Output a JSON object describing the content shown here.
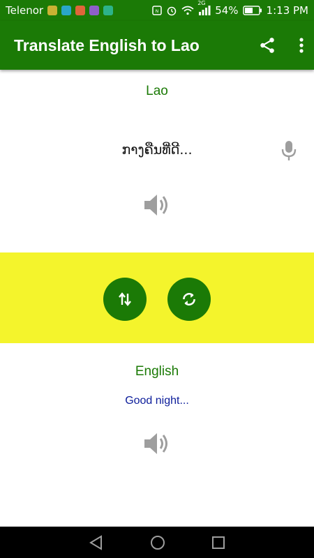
{
  "status_bar": {
    "carrier": "Telenor",
    "network": "2G",
    "battery": "54%",
    "time": "1:13 PM"
  },
  "app_bar": {
    "title": "Translate English to Lao",
    "icons": [
      "share-icon",
      "more-vert-icon"
    ]
  },
  "source": {
    "language": "Lao",
    "text": "ກາງຄືນທີ່ດີ..."
  },
  "controls": {
    "icons": [
      "swap-vertical-icon",
      "refresh-icon"
    ]
  },
  "target": {
    "language": "English",
    "text": "Good night..."
  },
  "colors": {
    "primary": "#1b7a06",
    "band": "#f4f42c",
    "translation_text": "#0b1c9a",
    "icon_gray": "#9e9e9e"
  }
}
